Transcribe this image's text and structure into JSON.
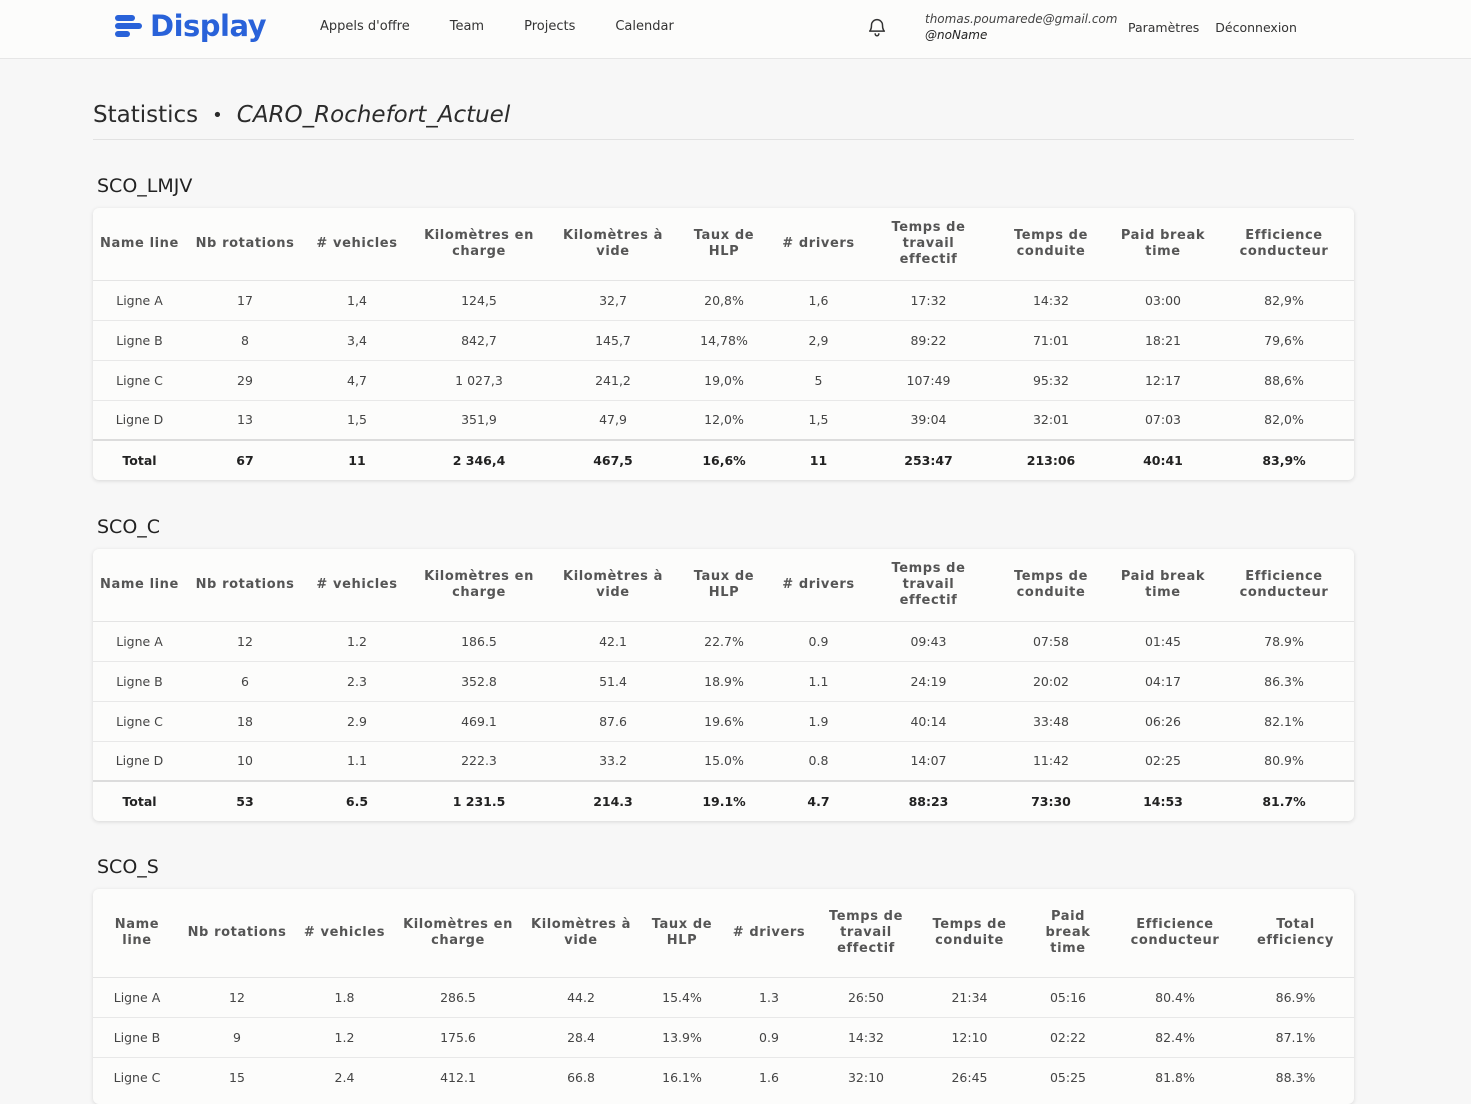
{
  "app": {
    "name": "Display",
    "primary_color": "#2962d9"
  },
  "nav": {
    "items": [
      "Appels d'offre",
      "Team",
      "Projects",
      "Calendar"
    ]
  },
  "user": {
    "email": "thomas.poumarede@gmail.com",
    "handle": "@noName"
  },
  "header_links": {
    "settings": "Paramètres",
    "logout": "Déconnexion"
  },
  "page": {
    "title": "Statistics",
    "separator": "•",
    "project": "CARO_Rochefort_Actuel"
  },
  "sections": [
    {
      "name": "SCO_LMJV",
      "headers": [
        "Name line",
        "Nb rotations",
        "# vehicles",
        "Kilomètres en charge",
        "Kilomètres à vide",
        "Taux de HLP",
        "# drivers",
        "Temps de travail effectif",
        "Temps de conduite",
        "Paid break time",
        "Efficience conducteur"
      ],
      "rows": [
        [
          "Ligne A",
          "17",
          "1,4",
          "124,5",
          "32,7",
          "20,8%",
          "1,6",
          "17:32",
          "14:32",
          "03:00",
          "82,9%"
        ],
        [
          "Ligne B",
          "8",
          "3,4",
          "842,7",
          "145,7",
          "14,78%",
          "2,9",
          "89:22",
          "71:01",
          "18:21",
          "79,6%"
        ],
        [
          "Ligne C",
          "29",
          "4,7",
          "1 027,3",
          "241,2",
          "19,0%",
          "5",
          "107:49",
          "95:32",
          "12:17",
          "88,6%"
        ],
        [
          "Ligne D",
          "13",
          "1,5",
          "351,9",
          "47,9",
          "12,0%",
          "1,5",
          "39:04",
          "32:01",
          "07:03",
          "82,0%"
        ]
      ],
      "total": [
        "Total",
        "67",
        "11",
        "2 346,4",
        "467,5",
        "16,6%",
        "11",
        "253:47",
        "213:06",
        "40:41",
        "83,9%"
      ]
    },
    {
      "name": "SCO_C",
      "headers": [
        "Name line",
        "Nb rotations",
        "# vehicles",
        "Kilomètres en charge",
        "Kilomètres à vide",
        "Taux de HLP",
        "# drivers",
        "Temps de travail effectif",
        "Temps de conduite",
        "Paid break time",
        "Efficience conducteur"
      ],
      "rows": [
        [
          "Ligne A",
          "12",
          "1.2",
          "186.5",
          "42.1",
          "22.7%",
          "0.9",
          "09:43",
          "07:58",
          "01:45",
          "78.9%"
        ],
        [
          "Ligne B",
          "6",
          "2.3",
          "352.8",
          "51.4",
          "18.9%",
          "1.1",
          "24:19",
          "20:02",
          "04:17",
          "86.3%"
        ],
        [
          "Ligne C",
          "18",
          "2.9",
          "469.1",
          "87.6",
          "19.6%",
          "1.9",
          "40:14",
          "33:48",
          "06:26",
          "82.1%"
        ],
        [
          "Ligne D",
          "10",
          "1.1",
          "222.3",
          "33.2",
          "15.0%",
          "0.8",
          "14:07",
          "11:42",
          "02:25",
          "80.9%"
        ]
      ],
      "total": [
        "Total",
        "53",
        "6.5",
        "1 231.5",
        "214.3",
        "19.1%",
        "4.7",
        "88:23",
        "73:30",
        "14:53",
        "81.7%"
      ]
    },
    {
      "name": "SCO_S",
      "headers": [
        "Name line",
        "Nb rotations",
        "# vehicles",
        "Kilomètres en charge",
        "Kilomètres à vide",
        "Taux de HLP",
        "# drivers",
        "Temps de travail effectif",
        "Temps de conduite",
        "Paid break time",
        "Efficience conducteur",
        "Total efficiency"
      ],
      "rows": [
        [
          "Ligne A",
          "12",
          "1.8",
          "286.5",
          "44.2",
          "15.4%",
          "1.3",
          "26:50",
          "21:34",
          "05:16",
          "80.4%",
          "86.9%"
        ],
        [
          "Ligne B",
          "9",
          "1.2",
          "175.6",
          "28.4",
          "13.9%",
          "0.9",
          "14:32",
          "12:10",
          "02:22",
          "82.4%",
          "87.1%"
        ],
        [
          "Ligne C",
          "15",
          "2.4",
          "412.1",
          "66.8",
          "16.1%",
          "1.6",
          "32:10",
          "26:45",
          "05:25",
          "81.8%",
          "88.3%"
        ]
      ]
    }
  ]
}
